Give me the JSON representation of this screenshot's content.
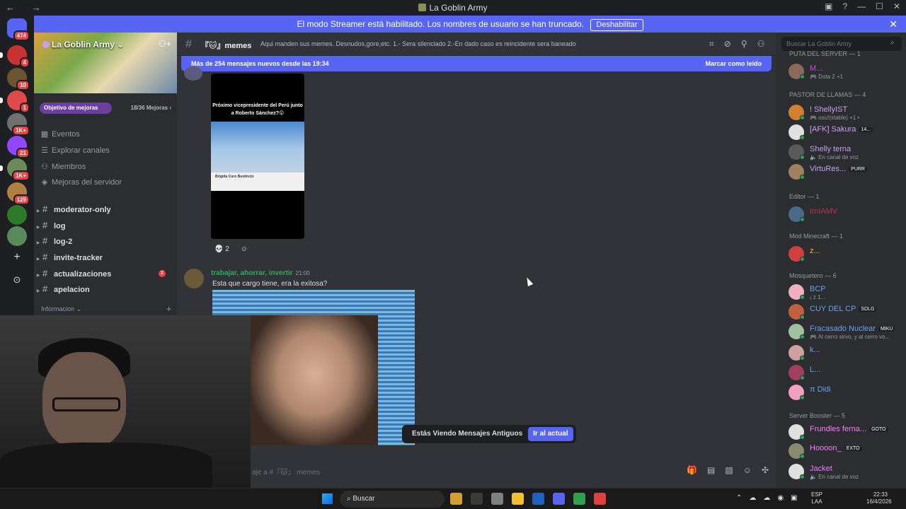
{
  "window": {
    "title": "La Goblin Army",
    "nav": "← →",
    "controls": [
      "▣",
      "?",
      "—",
      "☐",
      "✕"
    ]
  },
  "banner": {
    "text": "El modo Streamer está habilitado. Los nombres de usuario se han truncado.",
    "button": "Deshabilitar",
    "close": "✕"
  },
  "guilds": [
    {
      "color": "#5865f2",
      "badge": "474"
    },
    {
      "color": "#c83232",
      "badge": "4"
    },
    {
      "color": "#6a5530",
      "badge": "10"
    },
    {
      "color": "#e04a4a",
      "badge": "1"
    },
    {
      "color": "#707070",
      "badge": "1K+"
    },
    {
      "color": "#9146ff",
      "badge": "21"
    },
    {
      "color": "#6a8a5a",
      "badge": "1K+"
    },
    {
      "color": "#b08040",
      "badge": "129"
    },
    {
      "color": "#2a7a2a",
      "badge": ""
    },
    {
      "color": "#5a8a5a",
      "badge": ""
    }
  ],
  "server": {
    "name": "La Goblin Army",
    "boost_goal": "Objetivo de mejoras",
    "boost_count": "18/36 Mejoras ›",
    "menu": [
      {
        "label": "Eventos",
        "icon": "▦"
      },
      {
        "label": "Explorar canales",
        "icon": "☰"
      },
      {
        "label": "Miembros",
        "icon": "⚇"
      },
      {
        "label": "Mejoras del servidor",
        "icon": "◈"
      }
    ],
    "channels": [
      {
        "name": "moderator-only",
        "unread": ""
      },
      {
        "name": "log",
        "unread": ""
      },
      {
        "name": "log-2",
        "unread": ""
      },
      {
        "name": "invite-tracker",
        "unread": ""
      },
      {
        "name": "actualizaciones",
        "unread": "1"
      },
      {
        "name": "apelacion",
        "unread": ""
      }
    ],
    "category": "Informacion ⌄"
  },
  "channel": {
    "name": "『🐱』memes",
    "topic": "Aqui manden sus memes. Desnudos,gore,etc. 1.- Sera silenciado 2.-En dado caso es reincidente sera baneado",
    "new_messages": "Más de 254 mensajes nuevos desde las 19:34",
    "mark_read": "Marcar como leído"
  },
  "messages": {
    "embed_caption": "Próximo vicepresidente del Perú junto a Roberto Sánchez?😮",
    "embed_name": "Brigida Curo Bustincio",
    "reactions": [
      {
        "emoji": "💀",
        "count": "2"
      },
      {
        "emoji": "☺",
        "count": ""
      }
    ],
    "second_author": "trabajar, ahorrar, invertir",
    "second_time": "21:00",
    "second_text": "Esta que cargo tiene, era la exitosa?"
  },
  "old_messages": {
    "text": "Estás Viendo Mensajes Antiguos",
    "button": "Ir al actual"
  },
  "composer": {
    "placeholder": "aje a #『🐱』 memes"
  },
  "members": {
    "search_placeholder": "Buscar La Goblin Army",
    "groups": [
      {
        "title": "PUTA DEL SERVER — 1"
      },
      {
        "title": "PASTOR DE LLAMAS — 4"
      },
      {
        "title": "Editor — 1"
      },
      {
        "title": "Mod Minecraft — 1"
      },
      {
        "title": "Mosquetero — 6"
      },
      {
        "title": "Server Booster — 5"
      }
    ],
    "list": [
      {
        "name": "M...",
        "sub": "🎮 Dota 2 +1",
        "color": "#c050e0",
        "avatar": "#8a6a5a",
        "tag": ""
      },
      {
        "name": "! ShellyIST",
        "sub": "🎮 osu!(stable) +1 •",
        "color": "#c9a0f0",
        "avatar": "#d08030",
        "tag": ""
      },
      {
        "name": "[AFK] Sakura",
        "sub": "",
        "color": "#c9a0f0",
        "avatar": "#e0e0e0",
        "tag": "14..."
      },
      {
        "name": "Shelly terna",
        "sub": "🔈 En canal de voz",
        "color": "#c9a0f0",
        "avatar": "#5a5a5a",
        "tag": ""
      },
      {
        "name": "VirtuRes...",
        "sub": "",
        "color": "#c9a0f0",
        "avatar": "#a08060",
        "tag": "PURR"
      },
      {
        "name": "ImIAMV",
        "sub": "",
        "color": "#c03050",
        "avatar": "#4a6a8a",
        "tag": ""
      },
      {
        "name": "z...",
        "sub": "",
        "color": "#e0c040",
        "avatar": "#d04040",
        "tag": ""
      },
      {
        "name": "BCP",
        "sub": "¡ z 1...",
        "color": "#6aa0f0",
        "avatar": "#f0b0c0",
        "tag": ""
      },
      {
        "name": "CUY DEL CP",
        "sub": "",
        "color": "#6aa0f0",
        "avatar": "#c06040",
        "tag": "SDLG"
      },
      {
        "name": "Fracasado Nuclear",
        "sub": "🎮 Al cerro sirvo, y al cerro vo...",
        "color": "#6aa0f0",
        "avatar": "#a0c0a0",
        "tag": "MIKU"
      },
      {
        "name": "k...",
        "sub": "",
        "color": "#6aa0f0",
        "avatar": "#d0a0a0",
        "tag": ""
      },
      {
        "name": "L...",
        "sub": "",
        "color": "#6aa0f0",
        "avatar": "#a04060",
        "tag": ""
      },
      {
        "name": "π Didi",
        "sub": "",
        "color": "#6aa0f0",
        "avatar": "#f0a0c0",
        "tag": ""
      },
      {
        "name": "Frundles ferna...",
        "sub": "",
        "color": "#f47fff",
        "avatar": "#e0e0e0",
        "tag": "GOTO"
      },
      {
        "name": "Hoooon_",
        "sub": "",
        "color": "#f47fff",
        "avatar": "#8a8a70",
        "tag": "EXTO"
      },
      {
        "name": "Jacket",
        "sub": "🔈 En canal de voz",
        "color": "#f47fff",
        "avatar": "#e0e0e0",
        "tag": ""
      }
    ]
  },
  "taskbar": {
    "search": "Buscar",
    "apps": [
      "#d0a030",
      "#3a3a3a",
      "#808080",
      "#f0c030",
      "#2060c0",
      "#5865f2",
      "#30a050",
      "#e04040"
    ],
    "tray": [
      "⌃",
      "☁",
      "☁",
      "◉",
      "▣"
    ],
    "lang_top": "ESP",
    "lang_bottom": "LAA",
    "time": "22:33",
    "date": "16/4/2026"
  }
}
